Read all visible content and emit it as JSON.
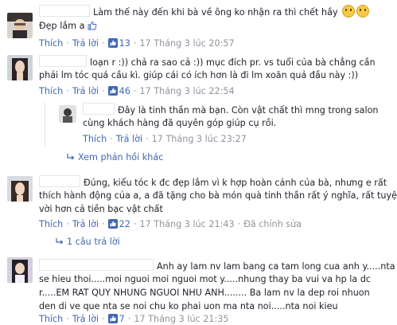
{
  "comments": [
    {
      "text_lines": [
        "Làm thế này đến khi bà về ông ko nhận ra thì chết hầy",
        "Đẹp lắm a"
      ],
      "like": "Thích",
      "reply": "Trả lời",
      "like_count": "13",
      "time": "17 Tháng 3 lúc 20:57"
    },
    {
      "text_lines": [
        "loạn r :)) chả ra sao cả :)) mục đích pr. vs tuổi của bà chẳng cần",
        "phải lm tóc quá cầu kì. giúp cái có ích hơn là đi lm xoăn quả đầu này :))"
      ],
      "like": "Thích",
      "reply": "Trả lời",
      "like_count": "46",
      "time": "17 Tháng 3 lúc 22:54",
      "reply_item": {
        "text_lines": [
          "Đây là tinh thần mà bạn. Còn vật chất thì mng trong salon",
          "cùng khách hàng đã quyên góp giúp cụ rồi."
        ],
        "like": "Thích",
        "reply": "Trả lời",
        "time": "17 Tháng 3 lúc 23:27"
      },
      "more_replies": "Xem phản hồi khác"
    },
    {
      "text_lines": [
        "Đúng, kiểu tóc k đc đẹp lắm vì k hợp hoàn cảnh của bà, nhưng e rất",
        "thích hành động của a, a đã tặng cho bà món quà tinh thần rất ý nghĩa, rất tuyệt",
        "vời hơn cả tiền bạc vật chất"
      ],
      "like": "Thích",
      "reply": "Trả lời",
      "like_count": "22",
      "time": "17 Tháng 3 lúc 21:43",
      "edited": "Đã chỉnh sửa",
      "replies_count": "1 câu trả lời"
    },
    {
      "text_lines": [
        "Anh ay lam nv lam bang ca tam long cua anh y.....nta",
        "se hieu thoi.....moi nguoi moi nguoi mot y.....nhung thay ba vui va hp la dc",
        "r.....EM RAT QUY NHUNG NGUOI NHU ANH........ Ba lam nv la dep roi nhuon",
        "den di ve que nta se noi chu ko phai uon ma nta noi.....nta noi kieu"
      ],
      "like": "Thích",
      "reply": "Trả lời",
      "like_count": "7",
      "time": "17 Tháng 3 lúc 21:35"
    }
  ],
  "colors": {
    "link": "#4267b2",
    "meta": "#90949c",
    "text": "#1d2129",
    "like_blue": "#4267b2"
  }
}
